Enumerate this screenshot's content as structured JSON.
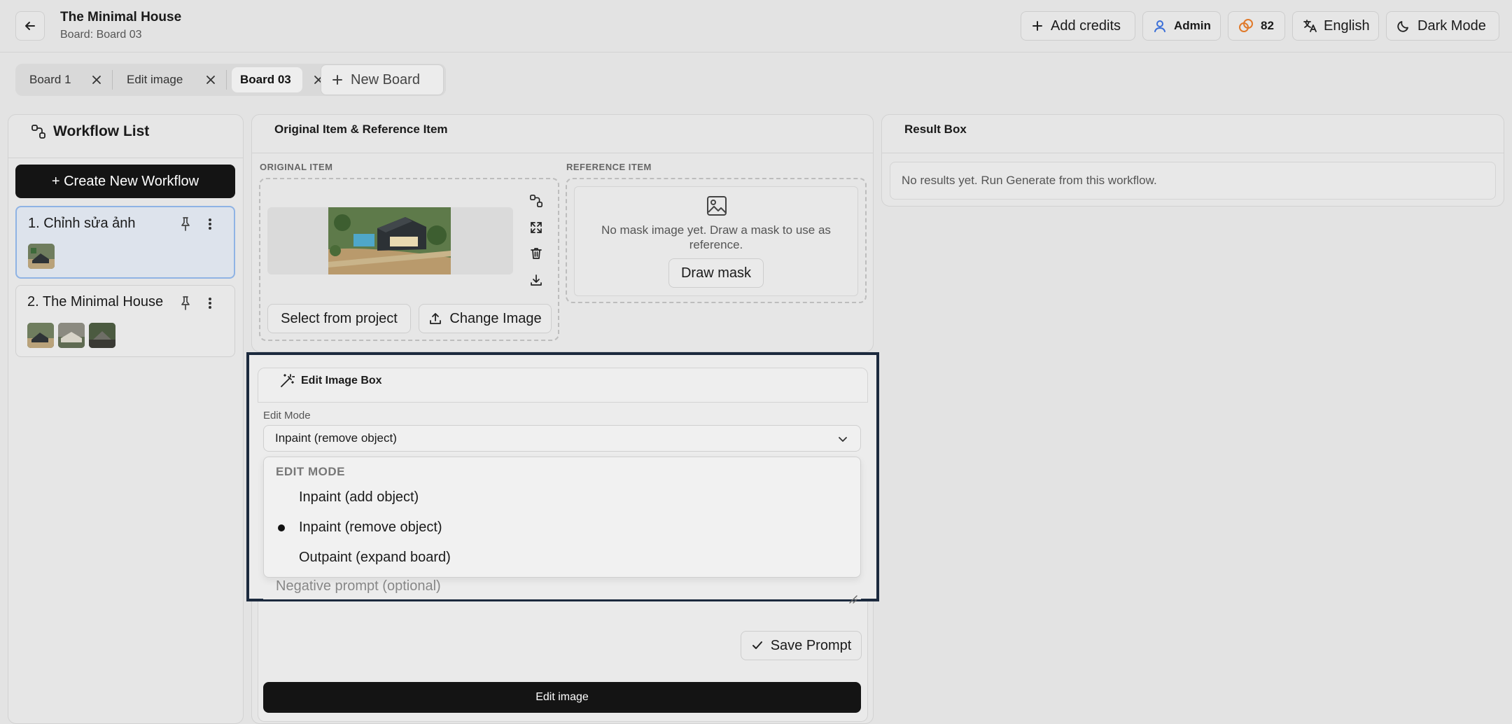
{
  "header": {
    "title": "The Minimal House",
    "subtitle": "Board: Board 03",
    "add_credits": "Add credits",
    "user": "Admin",
    "credits": "82",
    "language": "English",
    "theme": "Dark Mode"
  },
  "tabs": [
    {
      "label": "Board 1"
    },
    {
      "label": "Edit image"
    },
    {
      "label": "Board 03"
    }
  ],
  "new_board": "New Board",
  "workflow_list": {
    "title": "Workflow List",
    "create": "+ Create New Workflow",
    "items": [
      {
        "label": "1. Chỉnh sửa ảnh"
      },
      {
        "label": "2. The Minimal House"
      }
    ]
  },
  "original_panel": {
    "title": "Original Item & Reference Item",
    "original_label": "ORIGINAL ITEM",
    "reference_label": "REFERENCE ITEM",
    "select_project": "Select from project",
    "change_image": "Change Image",
    "no_mask": "No mask image yet. Draw a mask to use as reference.",
    "draw_mask": "Draw mask"
  },
  "result_box": {
    "title": "Result Box",
    "empty": "No results yet. Run Generate from this workflow."
  },
  "edit_box": {
    "title": "Edit Image Box",
    "edit_mode_label": "Edit Mode",
    "selected": "Inpaint (remove object)",
    "menu_heading": "EDIT MODE",
    "options": [
      "Inpaint (add object)",
      "Inpaint (remove object)",
      "Outpaint (expand board)"
    ],
    "negative_placeholder": "Negative prompt (optional)",
    "save_prompt": "Save Prompt",
    "edit_image": "Edit image"
  },
  "colors": {
    "accent_dark": "#141414",
    "selection_border": "#8fb3e4",
    "highlight_border": "#1c2a3e",
    "user_icon": "#3b6fd8",
    "credit_icon": "#e07a2b"
  }
}
